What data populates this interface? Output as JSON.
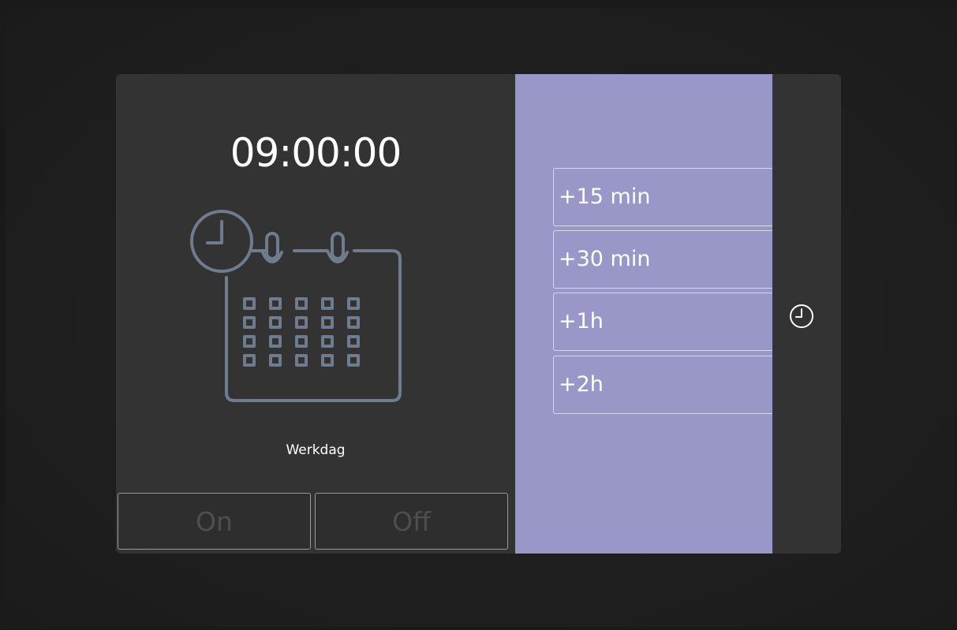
{
  "clock": {
    "time": "09:00:00"
  },
  "schedule": {
    "day_label": "Werkdag"
  },
  "toggle": {
    "on_label": "On",
    "off_label": "Off"
  },
  "add_time": {
    "buttons": [
      {
        "label": "+15 min"
      },
      {
        "label": "+30 min"
      },
      {
        "label": "+1h"
      },
      {
        "label": "+2h"
      }
    ]
  },
  "colors": {
    "panel": "#333333",
    "accent": "#9897c8",
    "icon_stroke": "#6f7c8e",
    "background": "#1a1a1a"
  },
  "icons": {
    "calendar": "calendar-clock-icon",
    "clock": "clock-icon"
  }
}
